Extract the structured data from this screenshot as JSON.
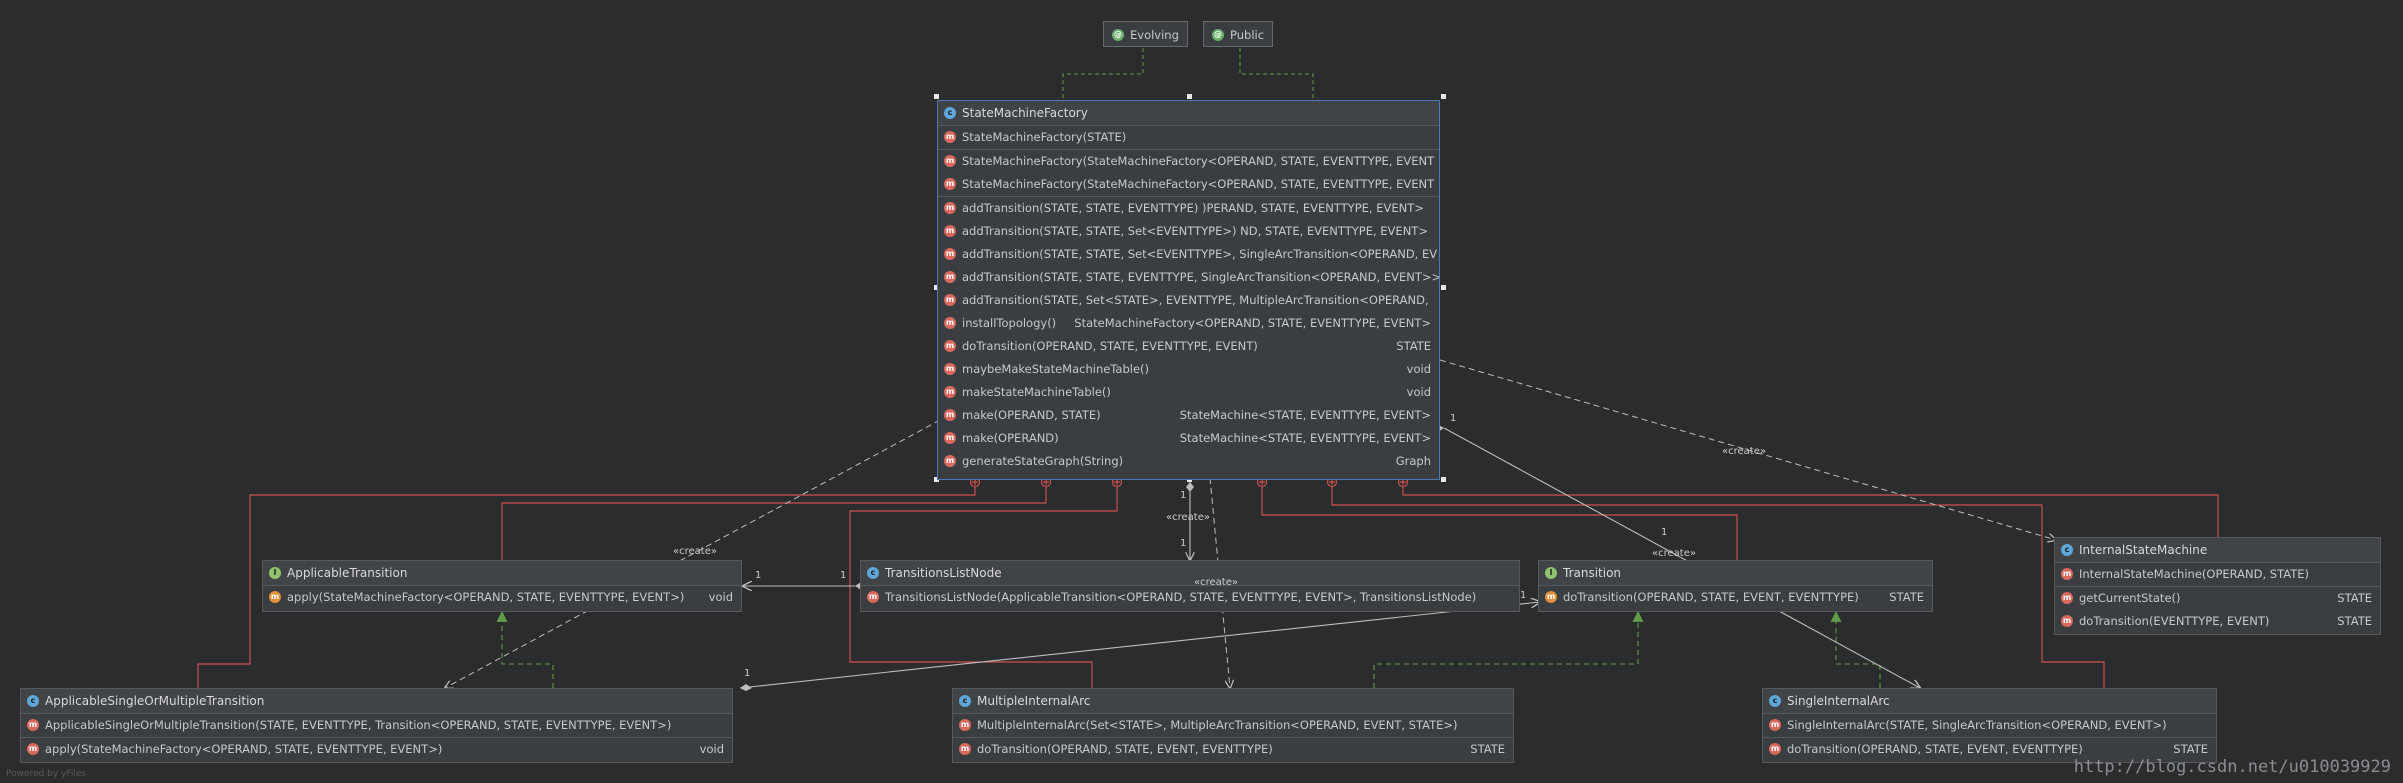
{
  "tags": [
    "Evolving",
    "Public"
  ],
  "classes": {
    "factory": {
      "name": "StateMachineFactory",
      "rows": [
        [
          "StateMachineFactory(STATE)",
          ""
        ],
        [
          "StateMachineFactory(StateMachineFactory<OPERAND, STATE, EVENTTYPE, EVENT",
          ""
        ],
        [
          "StateMachineFactory(StateMachineFactory<OPERAND, STATE, EVENTTYPE, EVENT",
          ""
        ],
        [
          "addTransition(STATE, STATE, EVENTTYPE) )PERAND, STATE, EVENTTYPE, EVENT>",
          ""
        ],
        [
          "addTransition(STATE, STATE, Set<EVENTTYPE>) ND, STATE, EVENTTYPE, EVENT>",
          ""
        ],
        [
          "addTransition(STATE, STATE, Set<EVENTTYPE>, SingleArcTransition<OPERAND, EV",
          ""
        ],
        [
          "addTransition(STATE, STATE, EVENTTYPE, SingleArcTransition<OPERAND, EVENT>>",
          ""
        ],
        [
          "addTransition(STATE, Set<STATE>, EVENTTYPE, MultipleArcTransition<OPERAND,",
          ""
        ],
        [
          "installTopology()",
          "StateMachineFactory<OPERAND, STATE, EVENTTYPE, EVENT>"
        ],
        [
          "doTransition(OPERAND, STATE, EVENTTYPE, EVENT)",
          "STATE"
        ],
        [
          "maybeMakeStateMachineTable()",
          "void"
        ],
        [
          "makeStateMachineTable()",
          "void"
        ],
        [
          "make(OPERAND, STATE)",
          "StateMachine<STATE, EVENTTYPE, EVENT>"
        ],
        [
          "make(OPERAND)",
          "StateMachine<STATE, EVENTTYPE, EVENT>"
        ],
        [
          "generateStateGraph(String)",
          "Graph"
        ]
      ]
    },
    "applicable": {
      "name": "ApplicableTransition",
      "rows": [
        [
          "apply(StateMachineFactory<OPERAND, STATE, EVENTTYPE, EVENT>)",
          "void"
        ]
      ]
    },
    "tln": {
      "name": "TransitionsListNode",
      "rows": [
        [
          "TransitionsListNode(ApplicableTransition<OPERAND, STATE, EVENTTYPE, EVENT>, TransitionsListNode)",
          ""
        ]
      ]
    },
    "transition": {
      "name": "Transition",
      "rows": [
        [
          "doTransition(OPERAND, STATE, EVENT, EVENTTYPE)",
          "STATE"
        ]
      ]
    },
    "ism": {
      "name": "InternalStateMachine",
      "rows": [
        [
          "InternalStateMachine(OPERAND, STATE)",
          ""
        ],
        [
          "getCurrentState()",
          "STATE"
        ],
        [
          "doTransition(EVENTTYPE, EVENT)",
          "STATE"
        ]
      ]
    },
    "asomt": {
      "name": "ApplicableSingleOrMultipleTransition",
      "rows": [
        [
          "ApplicableSingleOrMultipleTransition(STATE, EVENTTYPE, Transition<OPERAND, STATE, EVENTTYPE, EVENT>)",
          ""
        ],
        [
          "apply(StateMachineFactory<OPERAND, STATE, EVENTTYPE, EVENT>)",
          "void"
        ]
      ]
    },
    "mia": {
      "name": "MultipleInternalArc",
      "rows": [
        [
          "MultipleInternalArc(Set<STATE>, MultipleArcTransition<OPERAND, EVENT, STATE>)",
          ""
        ],
        [
          "doTransition(OPERAND, STATE, EVENT, EVENTTYPE)",
          "STATE"
        ]
      ]
    },
    "sia": {
      "name": "SingleInternalArc",
      "rows": [
        [
          "SingleInternalArc(STATE, SingleArcTransition<OPERAND, EVENT>)",
          ""
        ],
        [
          "doTransition(OPERAND, STATE, EVENT, EVENTTYPE)",
          "STATE"
        ]
      ]
    }
  },
  "edge_labels": {
    "create": "«create»",
    "one": "1"
  },
  "watermark": "http://blog.csdn.net/u010039929",
  "powered": "Powered by yFiles",
  "colors": {
    "background": "#2b2c2e",
    "inner_class_edge": "#c9524c",
    "dependency_edge": "#bdbdbd",
    "realization_edge": "#5f9c4a",
    "selection": "#4c79b8"
  }
}
